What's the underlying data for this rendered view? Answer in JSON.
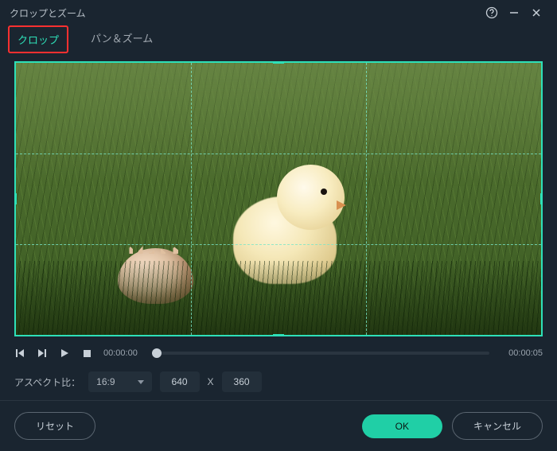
{
  "titlebar": {
    "title": "クロップとズーム"
  },
  "tabs": {
    "crop": "クロップ",
    "panzoom": "パン＆ズーム"
  },
  "playback": {
    "current_time": "00:00:00",
    "duration": "00:00:05"
  },
  "aspect": {
    "label": "アスペクト比：",
    "selected": "16:9",
    "width": "640",
    "sep": "X",
    "height": "360"
  },
  "footer": {
    "reset": "リセット",
    "ok": "OK",
    "cancel": "キャンセル"
  }
}
